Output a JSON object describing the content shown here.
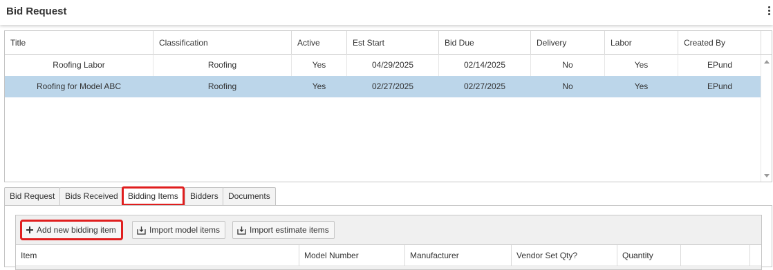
{
  "header": {
    "title": "Bid Request",
    "menu_icon": "kebab-menu-icon"
  },
  "grid": {
    "columns": [
      "Title",
      "Classification",
      "Active",
      "Est Start",
      "Bid Due",
      "Delivery",
      "Labor",
      "Created By"
    ],
    "rows": [
      {
        "title": "Roofing Labor",
        "classification": "Roofing",
        "active": "Yes",
        "est_start": "04/29/2025",
        "bid_due": "02/14/2025",
        "delivery": "No",
        "labor": "Yes",
        "created_by": "EPund",
        "selected": false
      },
      {
        "title": "Roofing for Model ABC",
        "classification": "Roofing",
        "active": "Yes",
        "est_start": "02/27/2025",
        "bid_due": "02/27/2025",
        "delivery": "No",
        "labor": "Yes",
        "created_by": "EPund",
        "selected": true
      }
    ]
  },
  "tabs": [
    {
      "label": "Bid Request",
      "active": false
    },
    {
      "label": "Bids Received",
      "active": false
    },
    {
      "label": "Bidding Items",
      "active": true
    },
    {
      "label": "Bidders",
      "active": false
    },
    {
      "label": "Documents",
      "active": false
    }
  ],
  "toolbar": {
    "add_label": "Add new bidding item",
    "import_model_label": "Import model items",
    "import_estimate_label": "Import estimate items"
  },
  "items_grid": {
    "columns": [
      "Item",
      "Model Number",
      "Manufacturer",
      "Vendor Set Qty?",
      "Quantity",
      ""
    ]
  },
  "colors": {
    "selected_row": "#bcd6ea",
    "highlight_outline": "#e01e1e",
    "border": "#c5c5c5"
  }
}
